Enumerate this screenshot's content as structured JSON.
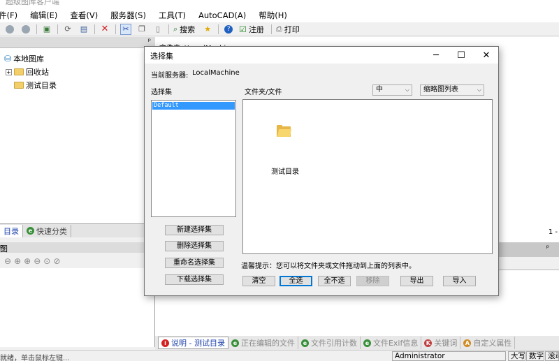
{
  "app": {
    "title": "超级图库客户端"
  },
  "menu": [
    "件(F)",
    "编辑(E)",
    "查看(V)",
    "服务器(S)",
    "工具(T)",
    "AutoCAD(A)",
    "帮助(H)"
  ],
  "toolbar": {
    "search_label": "搜索",
    "register_label": "注册",
    "print_label": "打印"
  },
  "left_panel": {
    "tree": {
      "root": "本地图库",
      "children": [
        "回收站",
        "测试目录"
      ]
    },
    "tabs": {
      "active": "目录",
      "inactive": "快速分类"
    },
    "lower_title": "图"
  },
  "right_panel": {
    "path_label": "文件夹: \\LocalMachine",
    "page_indicator": "1 -"
  },
  "bottom_tabs": [
    {
      "label": "说明 - 测试目录",
      "active": true,
      "icon_color": "#d42020",
      "glyph": "i"
    },
    {
      "label": "正在编辑的文件",
      "active": false,
      "icon_color": "#3a8f3a",
      "glyph": "e"
    },
    {
      "label": "文件引用计数",
      "active": false,
      "icon_color": "#3a8f3a",
      "glyph": "e"
    },
    {
      "label": "文件Exif信息",
      "active": false,
      "icon_color": "#3a8f3a",
      "glyph": "e"
    },
    {
      "label": "关键词",
      "active": false,
      "icon_color": "#c04040",
      "glyph": "K"
    },
    {
      "label": "自定义属性",
      "active": false,
      "icon_color": "#d08a20",
      "glyph": "A"
    }
  ],
  "status": {
    "left_text": "就绪，单击鼠标左键...",
    "user": "Administrator",
    "caps": "大写",
    "num": "数字",
    "scroll": "滚动"
  },
  "dialog": {
    "title": "选择集",
    "server_label": "当前服务器:",
    "server_value": "LocalMachine",
    "set_list_label": "选择集",
    "set_items": [
      "Default"
    ],
    "folder_file_label": "文件夹/文件",
    "size_combo": "中",
    "view_combo": "缩略图列表",
    "folder_item": "测试目录",
    "left_buttons": [
      "新建选择集",
      "删除选择集",
      "重命名选择集",
      "下载选择集"
    ],
    "hint": "温馨提示：您可以将文件夹或文件拖动到上面的列表中。",
    "bottom_buttons": {
      "clear": "清空",
      "select_all": "全选",
      "select_none": "全不选",
      "remove": "移除",
      "export": "导出",
      "import": "导入"
    }
  }
}
